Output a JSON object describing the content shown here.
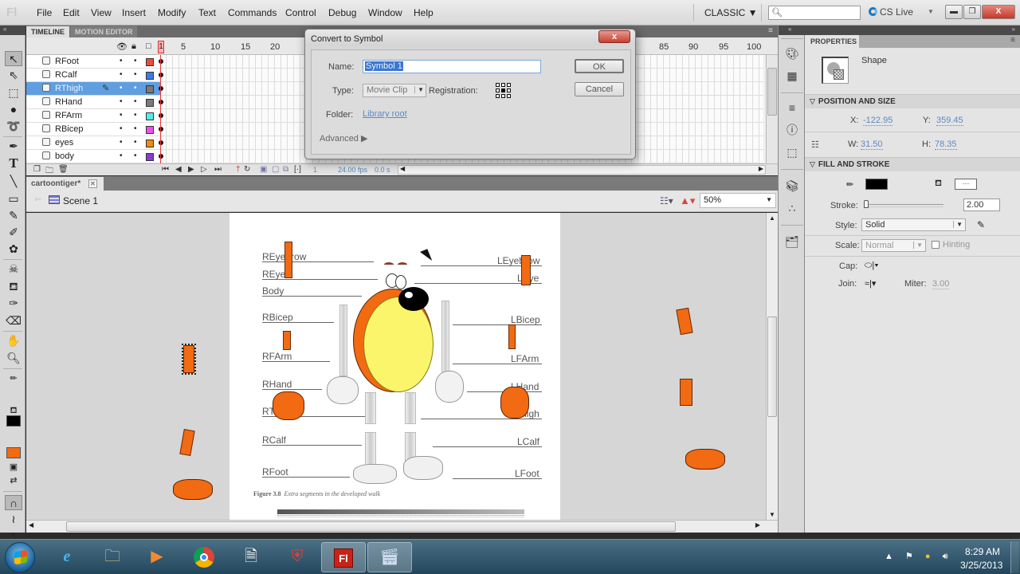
{
  "menubar": {
    "logo": "Fl",
    "items": [
      "File",
      "Edit",
      "View",
      "Insert",
      "Modify",
      "Text",
      "Commands",
      "Control",
      "Debug",
      "Window",
      "Help"
    ],
    "workspace": "CLASSIC ▼",
    "search_placeholder": "",
    "cs_live": "CS Live"
  },
  "timeline": {
    "tabs": [
      "TIMELINE",
      "MOTION EDITOR"
    ],
    "frame_numbers": [
      "1",
      "5",
      "10",
      "15",
      "20",
      "85",
      "90",
      "95",
      "100"
    ],
    "layers": [
      {
        "name": "RFoot",
        "color": "#f04a3a",
        "selected": false
      },
      {
        "name": "RCalf",
        "color": "#3b7be8",
        "selected": false
      },
      {
        "name": "RThigh",
        "color": "#7a7a7a",
        "selected": true
      },
      {
        "name": "RHand",
        "color": "#7a7a7a",
        "selected": false
      },
      {
        "name": "RFArm",
        "color": "#4fecec",
        "selected": false
      },
      {
        "name": "RBicep",
        "color": "#f04ef0",
        "selected": false
      },
      {
        "name": "eyes",
        "color": "#f08a10",
        "selected": false
      },
      {
        "name": "body",
        "color": "#8a3ad0",
        "selected": false
      }
    ],
    "current_frame": "1",
    "fps": "24.00 fps",
    "time": "0.0 s"
  },
  "document": {
    "tab": "cartoontiger*",
    "scene": "Scene 1",
    "zoom": "50%"
  },
  "reference_sheet": {
    "left_labels": [
      "REyebrow",
      "REye",
      "Body",
      "RBicep",
      "RFArm",
      "RHand",
      "RThigh",
      "RCalf",
      "RFoot"
    ],
    "right_labels": [
      "LEyebrow",
      "LEye",
      "LBicep",
      "LFArm",
      "LHand",
      "LThigh",
      "LCalf",
      "LFoot"
    ],
    "caption_bold": "Figure 3.8",
    "caption_italic": "Extra segments in the developed walk"
  },
  "dialog": {
    "title": "Convert to Symbol",
    "close": "x",
    "name_label": "Name:",
    "name_value": "Symbol 1",
    "type_label": "Type:",
    "type_value": "Movie Clip",
    "registration_label": "Registration:",
    "registration_selected": "center",
    "folder_label": "Folder:",
    "folder_value": "Library root",
    "advanced": "Advanced ▶",
    "ok": "OK",
    "cancel": "Cancel"
  },
  "properties": {
    "tab": "PROPERTIES",
    "object_type": "Shape",
    "position_section": "POSITION AND SIZE",
    "x_label": "X:",
    "x": "-122.95",
    "y_label": "Y:",
    "y": "359.45",
    "w_label": "W:",
    "w": "31.50",
    "h_label": "H:",
    "h": "78.35",
    "fill_section": "FILL AND STROKE",
    "stroke_color": "#000000",
    "fill_color_label": "---",
    "stroke_label": "Stroke:",
    "stroke_value": "2.00",
    "style_label": "Style:",
    "style_value": "Solid",
    "scale_label": "Scale:",
    "scale_value": "Normal",
    "hinting_label": "Hinting",
    "cap_label": "Cap:",
    "join_label": "Join:",
    "miter_label": "Miter:",
    "miter_value": "3.00"
  },
  "toolbar": {
    "stroke_color": "#000000",
    "fill_color": "#f26a12"
  },
  "taskbar": {
    "apps": [
      "internet-explorer",
      "windows-explorer",
      "media-player",
      "chrome",
      "notepad-document",
      "security-shield",
      "flash-professional",
      "screen-recorder"
    ],
    "flash_label": "Fl",
    "time": "8:29 AM",
    "date": "3/25/2013"
  }
}
